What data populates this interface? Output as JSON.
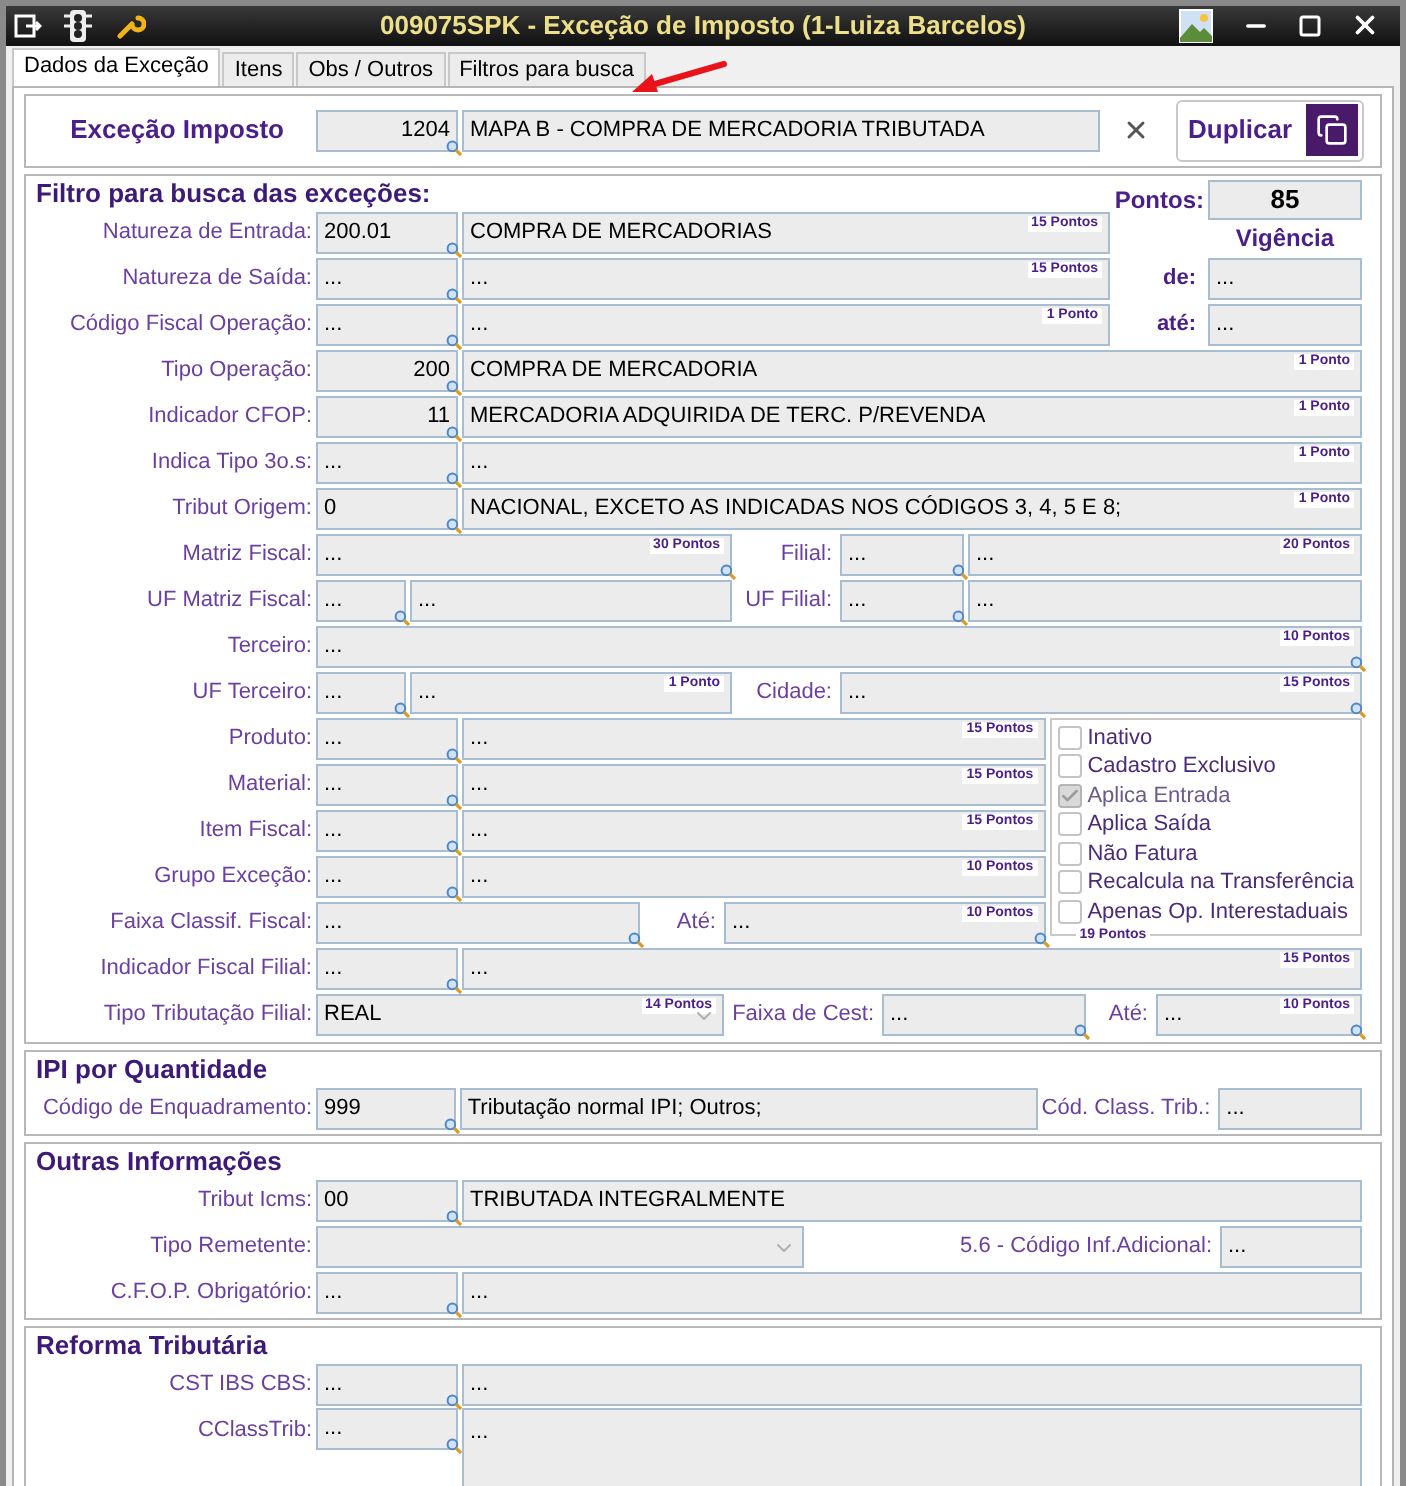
{
  "window": {
    "title": "009075SPK - Exceção de Imposto (1-Luiza Barcelos)"
  },
  "tabs": [
    {
      "label": "Dados da Exceção",
      "selected": true
    },
    {
      "label": "Itens",
      "selected": false
    },
    {
      "label": "Obs / Outros",
      "selected": false
    },
    {
      "label": "Filtros para busca",
      "selected": false
    }
  ],
  "header": {
    "label": "Exceção Imposto",
    "code": "1204",
    "description": "MAPA B - COMPRA DE MERCADORIA TRIBUTADA",
    "button": "Duplicar"
  },
  "filter": {
    "title": "Filtro para busca das exceções:",
    "pontos_label": "Pontos:",
    "pontos_value": "85",
    "vigencia_label": "Vigência",
    "de_label": "de:",
    "de_value": "...",
    "ate_label": "até:",
    "ate_value": "...",
    "rows": [
      {
        "label": "Natureza de Entrada:",
        "items": [
          {
            "kind": "lookup",
            "value": "200.01"
          },
          {
            "kind": "desc",
            "value": "COMPRA DE MERCADORIAS",
            "points": "15 Pontos"
          }
        ]
      },
      {
        "label": "Natureza de Saída:",
        "items": [
          {
            "kind": "lookup",
            "value": "..."
          },
          {
            "kind": "desc",
            "value": "...",
            "points": "15 Pontos"
          }
        ]
      },
      {
        "label": "Código Fiscal Operação:",
        "items": [
          {
            "kind": "lookup",
            "value": "..."
          },
          {
            "kind": "desc",
            "value": "...",
            "points": "1 Ponto"
          }
        ]
      },
      {
        "label": "Tipo Operação:",
        "items": [
          {
            "kind": "number",
            "value": "200"
          },
          {
            "kind": "desc",
            "value": "COMPRA DE MERCADORIA",
            "points": "1 Ponto"
          }
        ]
      },
      {
        "label": "Indicador CFOP:",
        "items": [
          {
            "kind": "number",
            "value": "11"
          },
          {
            "kind": "desc",
            "value": "MERCADORIA ADQUIRIDA DE TERC. P/REVENDA",
            "points": "1 Ponto"
          }
        ]
      },
      {
        "label": "Indica Tipo 3o.s:",
        "items": [
          {
            "kind": "lookup",
            "value": "..."
          },
          {
            "kind": "desc",
            "value": "...",
            "points": "1 Ponto"
          }
        ]
      },
      {
        "label": "Tribut Origem:",
        "items": [
          {
            "kind": "lookup",
            "value": "0"
          },
          {
            "kind": "desc",
            "value": "NACIONAL, EXCETO AS INDICADAS NOS CÓDIGOS 3, 4, 5 E 8;",
            "points": "1 Ponto"
          }
        ]
      },
      {
        "label": "Matriz Fiscal:",
        "items": [
          {
            "kind": "lookup",
            "value": "...",
            "points": "30 Pontos"
          },
          {
            "kind": "label",
            "text": "Filial:"
          },
          {
            "kind": "lookup",
            "value": "..."
          },
          {
            "kind": "desc",
            "value": "...",
            "points": "20 Pontos"
          }
        ]
      },
      {
        "label": "UF Matriz Fiscal:",
        "items": [
          {
            "kind": "lookup",
            "value": "..."
          },
          {
            "kind": "desc",
            "value": "..."
          },
          {
            "kind": "label",
            "text": "UF Filial:"
          },
          {
            "kind": "lookup",
            "value": "..."
          },
          {
            "kind": "desc",
            "value": "..."
          }
        ]
      },
      {
        "label": "Terceiro:",
        "items": [
          {
            "kind": "lookup",
            "value": "...",
            "points": "10 Pontos"
          }
        ]
      },
      {
        "label": "UF Terceiro:",
        "items": [
          {
            "kind": "lookup",
            "value": "..."
          },
          {
            "kind": "desc",
            "value": "...",
            "points": "1 Ponto"
          },
          {
            "kind": "label",
            "text": "Cidade:"
          },
          {
            "kind": "lookup",
            "value": "...",
            "points": "15 Pontos"
          }
        ]
      },
      {
        "label": "Produto:",
        "items": [
          {
            "kind": "lookup",
            "value": "..."
          },
          {
            "kind": "desc",
            "value": "...",
            "points": "15 Pontos"
          }
        ]
      },
      {
        "label": "Material:",
        "items": [
          {
            "kind": "lookup",
            "value": "..."
          },
          {
            "kind": "desc",
            "value": "...",
            "points": "15 Pontos"
          }
        ]
      },
      {
        "label": "Item Fiscal:",
        "items": [
          {
            "kind": "lookup",
            "value": "..."
          },
          {
            "kind": "desc",
            "value": "...",
            "points": "15 Pontos"
          }
        ]
      },
      {
        "label": "Grupo Exceção:",
        "items": [
          {
            "kind": "lookup",
            "value": "..."
          },
          {
            "kind": "desc",
            "value": "...",
            "points": "10 Pontos"
          }
        ]
      },
      {
        "label": "Faixa Classif. Fiscal:",
        "items": [
          {
            "kind": "lookup",
            "value": "..."
          },
          {
            "kind": "label",
            "text": "Até:"
          },
          {
            "kind": "lookup",
            "value": "...",
            "points": "10 Pontos"
          }
        ]
      },
      {
        "label": "Indicador Fiscal Filial:",
        "items": [
          {
            "kind": "lookup",
            "value": "..."
          },
          {
            "kind": "desc",
            "value": "...",
            "points": "15 Pontos"
          }
        ]
      },
      {
        "label": "Tipo Tributação Filial:",
        "items": [
          {
            "kind": "select",
            "value": "REAL",
            "points": "14 Pontos"
          },
          {
            "kind": "label",
            "text": "Faixa de Cest:"
          },
          {
            "kind": "lookup",
            "value": "..."
          },
          {
            "kind": "label",
            "text": "Até:"
          },
          {
            "kind": "lookup",
            "value": "...",
            "points": "10 Pontos"
          }
        ]
      }
    ],
    "checkboxes": [
      {
        "label": "Inativo",
        "checked": false,
        "disabled": false
      },
      {
        "label": "Cadastro Exclusivo",
        "checked": false,
        "disabled": false
      },
      {
        "label": "Aplica Entrada",
        "checked": true,
        "disabled": true
      },
      {
        "label": "Aplica Saída",
        "checked": false,
        "disabled": false
      },
      {
        "label": "Não Fatura",
        "checked": false,
        "disabled": false
      },
      {
        "label": "Recalcula na Transferência",
        "checked": false,
        "disabled": false
      },
      {
        "label": "Apenas Op. Interestaduais",
        "checked": false,
        "disabled": false
      }
    ],
    "checkboxes_points": "19 Pontos"
  },
  "sections": [
    {
      "title": "IPI por Quantidade",
      "rows": [
        {
          "label": "Código de Enquadramento:",
          "items": [
            {
              "kind": "lookup",
              "value": "999"
            },
            {
              "kind": "desc",
              "value": "Tributação normal IPI; Outros;"
            },
            {
              "kind": "label",
              "text": "Cód. Class. Trib.:"
            },
            {
              "kind": "plain",
              "value": "..."
            }
          ]
        }
      ]
    },
    {
      "title": "Outras Informações",
      "rows": [
        {
          "label": "Tribut Icms:",
          "items": [
            {
              "kind": "lookup",
              "value": "00"
            },
            {
              "kind": "desc",
              "value": "TRIBUTADA INTEGRALMENTE"
            }
          ]
        },
        {
          "label": "Tipo Remetente:",
          "items": [
            {
              "kind": "select"
            },
            {
              "kind": "label",
              "text": "5.6 - Código Inf.Adicional:"
            },
            {
              "kind": "plain",
              "value": "..."
            }
          ]
        },
        {
          "label": "C.F.O.P. Obrigatório:",
          "items": [
            {
              "kind": "lookup",
              "value": "..."
            },
            {
              "kind": "desc",
              "value": "..."
            }
          ]
        }
      ]
    },
    {
      "title": "Reforma Tributária",
      "rows": [
        {
          "label": "CST IBS CBS:",
          "items": [
            {
              "kind": "lookup",
              "value": "..."
            },
            {
              "kind": "desc",
              "value": "..."
            }
          ]
        },
        {
          "label": "CClassTrib:",
          "items": [
            {
              "kind": "lookup",
              "value": "..."
            },
            {
              "kind": "memo",
              "value": "..."
            }
          ]
        }
      ]
    }
  ]
}
